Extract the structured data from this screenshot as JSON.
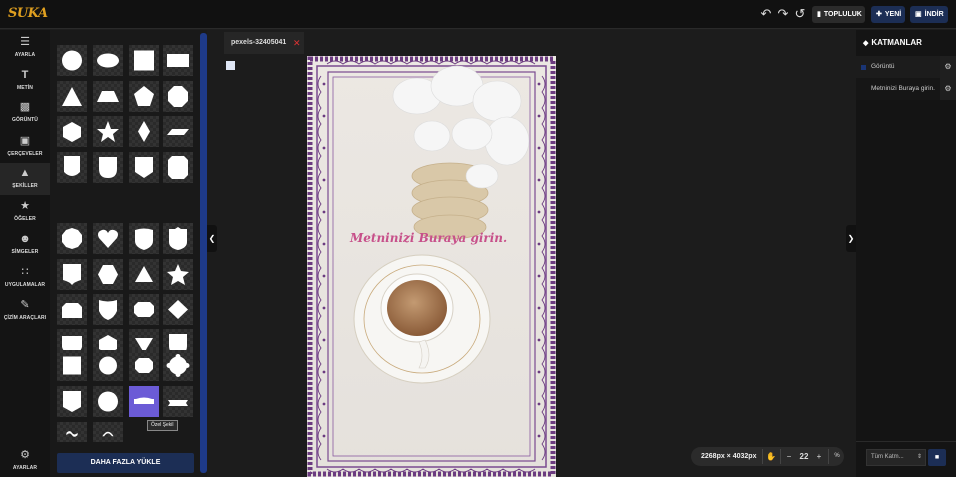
{
  "logo": "SUKA",
  "topbar": {
    "undo_icon": "undo-icon",
    "redo_icon": "redo-icon",
    "history_icon": "history-icon",
    "community_label": "TOPLULUK",
    "new_label": "YENİ",
    "download_label": "İNDİR"
  },
  "sidebar": {
    "items": [
      {
        "label": "AYARLA",
        "icon": "sliders-icon"
      },
      {
        "label": "METİN",
        "icon": "text-icon"
      },
      {
        "label": "GÖRÜNTÜ",
        "icon": "image-icon"
      },
      {
        "label": "ÇERÇEVELER",
        "icon": "frame-icon"
      },
      {
        "label": "ŞEKİLLER",
        "icon": "shapes-icon"
      },
      {
        "label": "ÖĞELER",
        "icon": "star-icon"
      },
      {
        "label": "SİMGELER",
        "icon": "smiley-icon"
      },
      {
        "label": "UYGULAMALAR",
        "icon": "apps-grid-icon"
      },
      {
        "label": "ÇİZİM ARAÇLARI",
        "icon": "brush-icon"
      }
    ],
    "settings_label": "AYARLAR"
  },
  "shapes_panel": {
    "load_more_label": "DAHA FAZLA YÜKLE",
    "tooltip": "Özel Şekil"
  },
  "document": {
    "tab_name": "pexels-32405041",
    "canvas_text": "Metninizi Buraya girin."
  },
  "zoom": {
    "canvas_size": "2268px × 4032px",
    "level": "22",
    "unit": "%"
  },
  "layers_panel": {
    "title": "KATMANLAR",
    "layers": [
      {
        "label": "Görüntü"
      },
      {
        "label": "Metninizi Buraya girin."
      }
    ],
    "filter_value": "Tüm Katm..."
  }
}
